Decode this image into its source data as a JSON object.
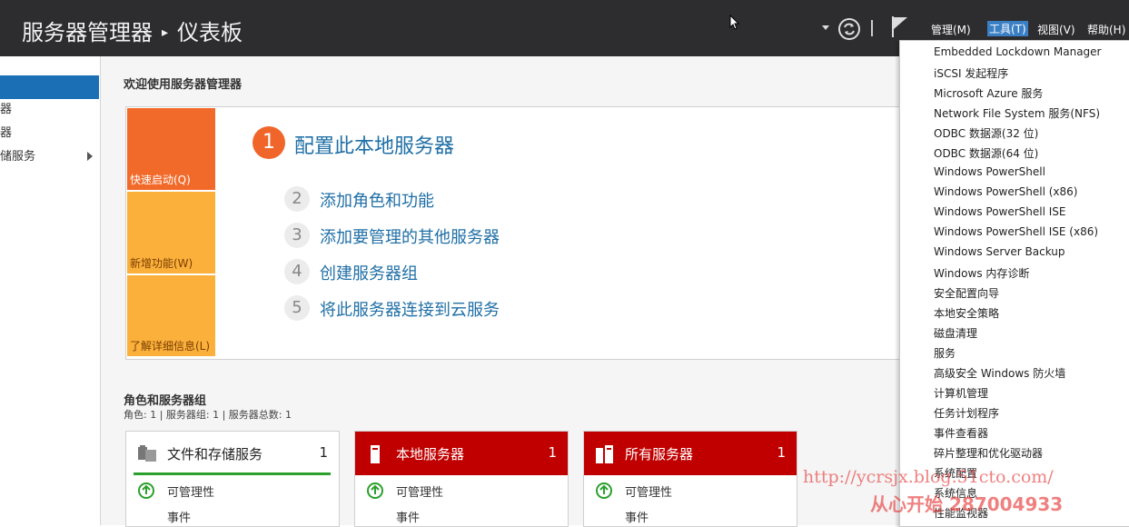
{
  "titlebar": {
    "title": "服务器管理器",
    "page": "仪表板",
    "menus": [
      "管理(M)",
      "工具(T)",
      "视图(V)",
      "帮助(H)"
    ]
  },
  "nav": {
    "items": [
      "",
      "器",
      "器",
      "储服务"
    ]
  },
  "welcome": {
    "title": "欢迎使用服务器管理器",
    "tiles": [
      "快速启动(Q)",
      "新增功能(W)",
      "了解详细信息(L)"
    ],
    "main_step": {
      "num": "1",
      "text": "配置此本地服务器"
    },
    "steps": [
      {
        "num": "2",
        "text": "添加角色和功能"
      },
      {
        "num": "3",
        "text": "添加要管理的其他服务器"
      },
      {
        "num": "4",
        "text": "创建服务器组"
      },
      {
        "num": "5",
        "text": "将此服务器连接到云服务"
      }
    ]
  },
  "roles": {
    "title": "角色和服务器组",
    "subtitle": "角色: 1 | 服务器组: 1 | 服务器总数: 1",
    "cards": [
      {
        "name": "文件和存储服务",
        "count": "1",
        "row1": "可管理性",
        "row2": "事件"
      },
      {
        "name": "本地服务器",
        "count": "1",
        "row1": "可管理性",
        "row2": "事件"
      },
      {
        "name": "所有服务器",
        "count": "1",
        "row1": "可管理性",
        "row2": "事件"
      }
    ]
  },
  "tools_menu": [
    "Embedded Lockdown Manager",
    "iSCSI 发起程序",
    "Microsoft Azure 服务",
    "Network File System 服务(NFS)",
    "ODBC 数据源(32 位)",
    "ODBC 数据源(64 位)",
    "Windows PowerShell",
    "Windows PowerShell (x86)",
    "Windows PowerShell ISE",
    "Windows PowerShell ISE (x86)",
    "Windows Server Backup",
    "Windows 内存诊断",
    "安全配置向导",
    "本地安全策略",
    "磁盘清理",
    "服务",
    "高级安全 Windows 防火墙",
    "计算机管理",
    "任务计划程序",
    "事件查看器",
    "碎片整理和优化驱动器",
    "系统配置",
    "系统信息",
    "性能监视器"
  ],
  "watermark": {
    "line1": "http://ycrsjx.blog.51cto.com/",
    "line2": "从心开始 287004933"
  },
  "colors": {
    "titlebar": "#2d2d30",
    "accent_blue": "#1a6fb5",
    "orange": "#f0662a",
    "tile_orange_dark": "#f26a2a",
    "tile_orange_light": "#fbb03b",
    "server_red": "#c00000",
    "ok_green": "#2ca02c"
  },
  "icons": [
    "refresh-icon",
    "flag-icon",
    "dropdown-caret-icon",
    "mouse-cursor-icon",
    "file-storage-icon",
    "server-icon",
    "servers-icon",
    "ok-check-icon"
  ]
}
